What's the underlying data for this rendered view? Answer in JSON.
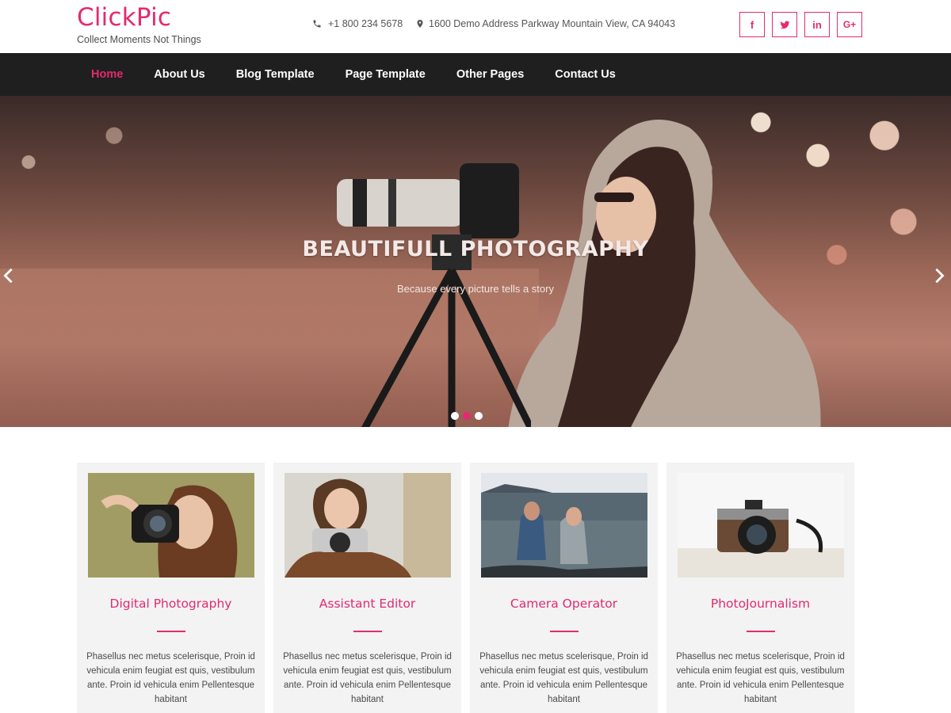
{
  "brand": {
    "title": "ClickPic",
    "tagline": "Collect Moments Not Things"
  },
  "contact": {
    "phone": "+1 800 234 5678",
    "address": "1600 Demo Address Parkway Mountain View, CA 94043"
  },
  "social": [
    {
      "icon": "facebook-icon",
      "glyph": "f"
    },
    {
      "icon": "twitter-icon",
      "glyph": "t"
    },
    {
      "icon": "linkedin-icon",
      "glyph": "in"
    },
    {
      "icon": "google-plus-icon",
      "glyph": "G+"
    }
  ],
  "nav": {
    "items": [
      {
        "label": "Home",
        "active": true
      },
      {
        "label": "About Us"
      },
      {
        "label": "Blog Template"
      },
      {
        "label": "Page Template"
      },
      {
        "label": "Other Pages"
      },
      {
        "label": "Contact Us"
      }
    ]
  },
  "hero": {
    "title": "BEAUTIFULL PHOTOGRAPHY",
    "subtitle": "Because every picture tells a story",
    "slide_count": 3,
    "active_slide": 2
  },
  "cards": [
    {
      "title": "Digital Photography",
      "text": "Phasellus nec metus scelerisque, Proin id vehicula enim feugiat est quis, vestibulum ante. Proin id vehicula enim Pellentesque habitant"
    },
    {
      "title": "Assistant Editor",
      "text": "Phasellus nec metus scelerisque, Proin id vehicula enim feugiat est quis, vestibulum ante. Proin id vehicula enim Pellentesque habitant"
    },
    {
      "title": "Camera Operator",
      "text": "Phasellus nec metus scelerisque, Proin id vehicula enim feugiat est quis, vestibulum ante. Proin id vehicula enim Pellentesque habitant"
    },
    {
      "title": "PhotoJournalism",
      "text": "Phasellus nec metus scelerisque, Proin id vehicula enim feugiat est quis, vestibulum ante. Proin id vehicula enim Pellentesque habitant"
    }
  ],
  "colors": {
    "accent": "#e32a6f",
    "nav_bg": "#1f1f1f",
    "card_bg": "#f3f3f3"
  }
}
